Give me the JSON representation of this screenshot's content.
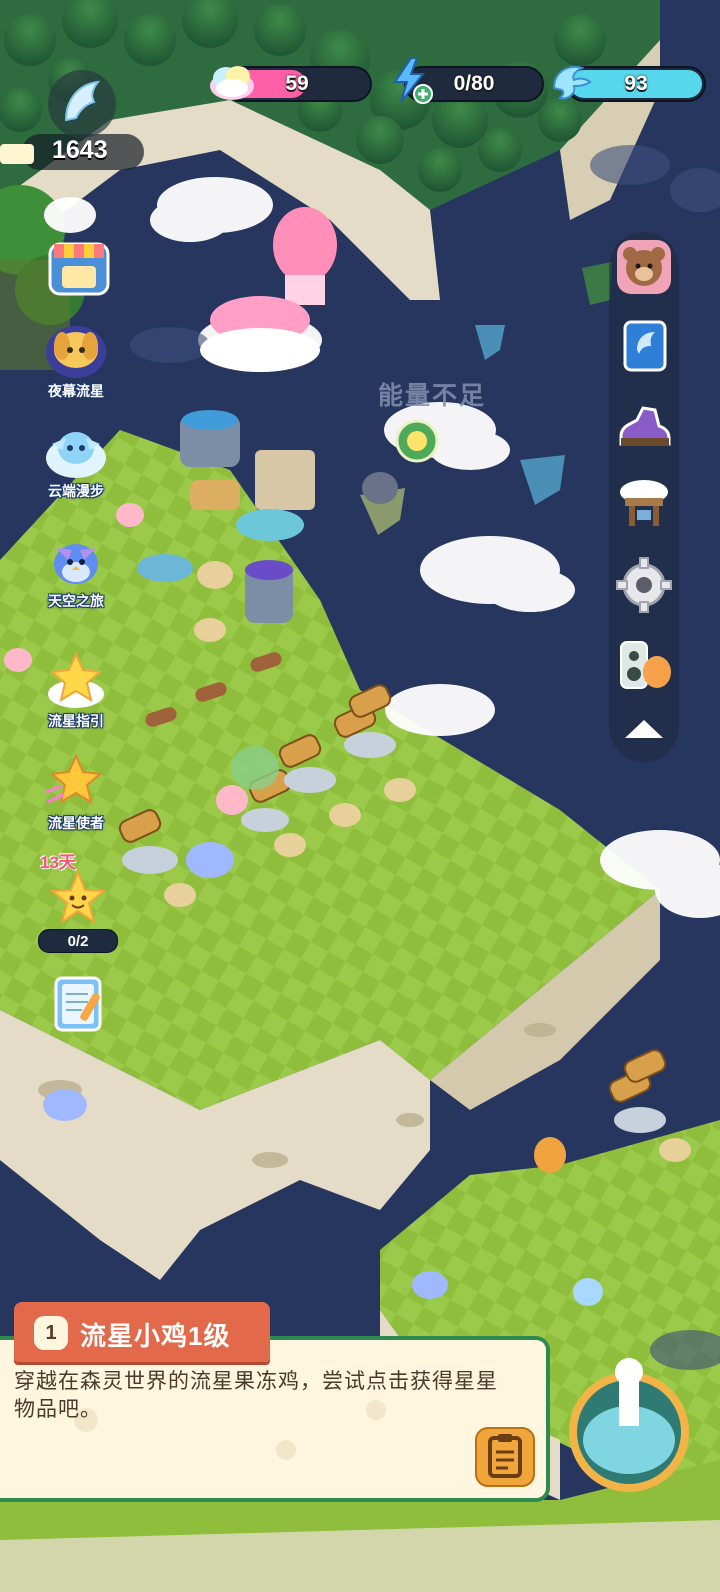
{
  "resources": {
    "pink_value": "59",
    "energy_value": "0/80",
    "wing_value": "93",
    "pink_fill": 0.55,
    "wing_fill": 1.0
  },
  "feather_currency": "1643",
  "floating_text": "能量不足",
  "left_features": [
    {
      "label": "夜幕流星",
      "icon": "night-dog-icon"
    },
    {
      "label": "云端漫步",
      "icon": "cloud-bird-icon"
    },
    {
      "label": "天空之旅",
      "icon": "sky-bird-icon"
    },
    {
      "label": "流星指引",
      "icon": "star-cloud-icon"
    },
    {
      "label": "流星使者",
      "icon": "star-messenger-icon"
    }
  ],
  "event_days": "13天",
  "event_progress": "0/2",
  "right_menu": [
    "bear-icon",
    "book-icon",
    "shoe-icon",
    "cloud-stall-icon",
    "gear-icon",
    "speaker-icon",
    "collapse-arrow-icon"
  ],
  "panel": {
    "level_number": "1",
    "title": "流星小鸡1级",
    "description": "穿越在森灵世界的流星果冻鸡，尝试点击获得星星物品吧。"
  },
  "colors": {
    "sea": "#27365f",
    "grass": "#8fbe3c",
    "cliff": "#e4dcc6",
    "panel_green": "#2f8a52",
    "tab_orange": "#e26a4a"
  }
}
